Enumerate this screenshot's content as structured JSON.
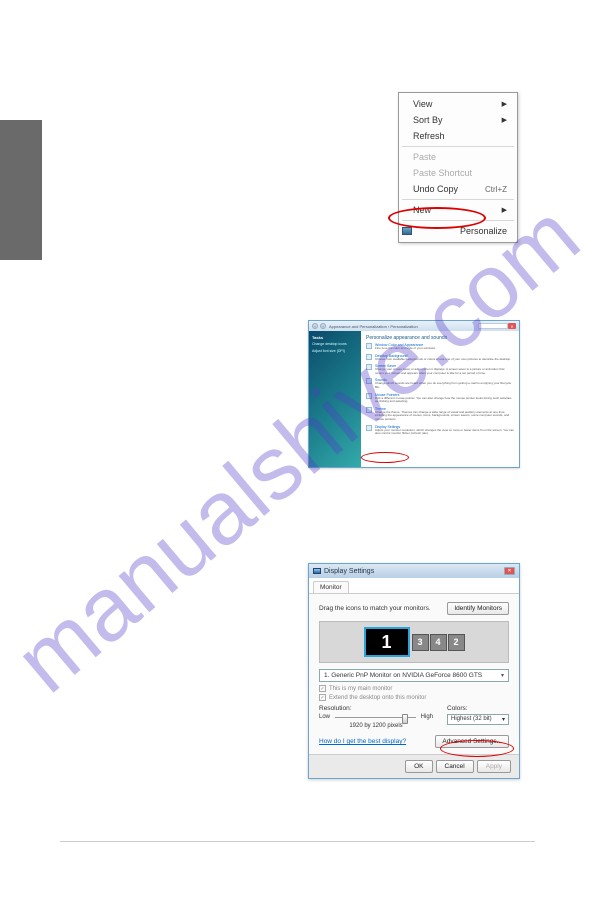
{
  "watermark": "manualshive.com",
  "context_menu": {
    "view": "View",
    "sort_by": "Sort By",
    "refresh": "Refresh",
    "paste": "Paste",
    "paste_shortcut": "Paste Shortcut",
    "undo_copy": "Undo Copy",
    "undo_shortcut": "Ctrl+Z",
    "new": "New",
    "personalize": "Personalize"
  },
  "personalize_window": {
    "path": "Appearance and Personalization › Personalization",
    "search": "Search",
    "side_tasks": "Tasks",
    "side_link1": "Change desktop icons",
    "side_link2": "Adjust font size (DPI)",
    "heading": "Personalize appearance and sounds",
    "rows": {
      "r1t": "Window Color and Appearance",
      "r1d": "Fine tune the color and style of your windows.",
      "r2t": "Desktop Background",
      "r2d": "Choose from available backgrounds or colors or use one of your own pictures to decorate the desktop.",
      "r3t": "Screen Saver",
      "r3d": "Change your screen saver or adjust when it displays. A screen saver is a picture or animation that covers your screen and appears when your computer is idle for a set period of time.",
      "r4t": "Sounds",
      "r4d": "Change which sounds are heard when you do everything from getting e-mail to emptying your Recycle Bin.",
      "r5t": "Mouse Pointers",
      "r5d": "Pick a different mouse pointer. You can also change how the mouse pointer looks during such activities as clicking and selecting.",
      "r6t": "Theme",
      "r6d": "Change the theme. Themes can change a wide range of visual and auditory elements at one time, including the appearance of menus, icons, backgrounds, screen savers, some computer sounds, and mouse pointers.",
      "r7t": "Display Settings",
      "r7d": "Adjust your monitor resolution, which changes the view so more or fewer items fit on the screen. You can also control monitor flicker (refresh rate)."
    }
  },
  "display_window": {
    "title": "Display Settings",
    "tab": "Monitor",
    "instruction": "Drag the icons to match your monitors.",
    "identify": "Identify Monitors",
    "monitors": {
      "m1": "1",
      "m2": "2",
      "m3": "3",
      "m4": "4"
    },
    "dropdown": "1. Generic PnP Monitor on NVIDIA GeForce 8600 GTS",
    "check1": "This is my main monitor",
    "check2": "Extend the desktop onto this monitor",
    "res_label": "Resolution:",
    "res_low": "Low",
    "res_high": "High",
    "res_value": "1920 by 1200 pixels",
    "col_label": "Colors:",
    "col_value": "Highest (32 bit)",
    "help_link": "How do I get the best display?",
    "advanced": "Advanced Settings...",
    "ok": "OK",
    "cancel": "Cancel",
    "apply": "Apply"
  }
}
